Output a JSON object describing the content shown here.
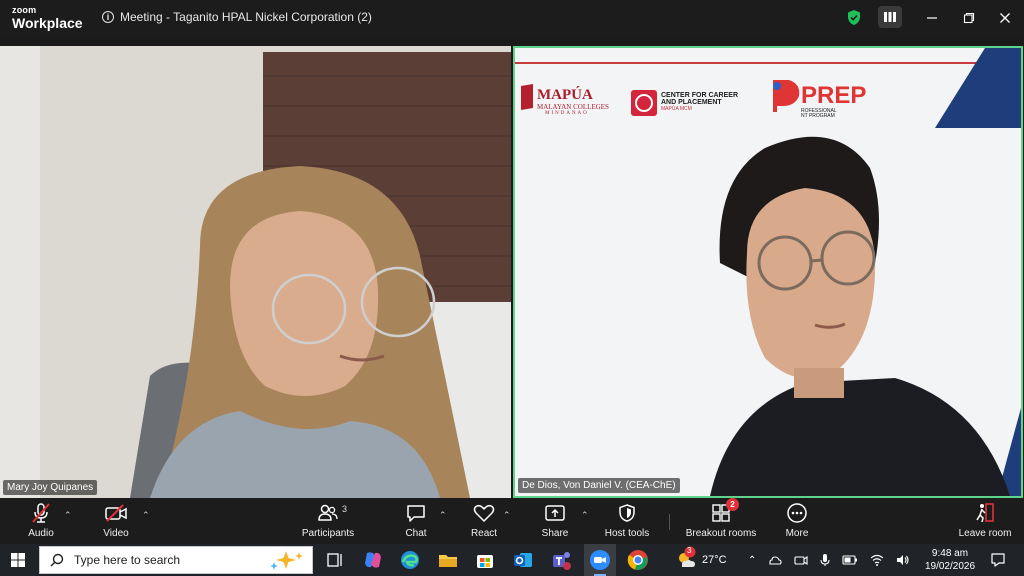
{
  "titlebar": {
    "brand_top": "zoom",
    "brand_main": "Workplace",
    "meeting_title": "Meeting - Taganito HPAL Nickel Corporation (2)"
  },
  "participants": [
    {
      "name": "Mary Joy Quipanes"
    },
    {
      "name": "De Dios, Von Daniel V. (CEA-ChE)"
    }
  ],
  "backdrop": {
    "logo1_main": "MAPÚA",
    "logo1_sub": "MALAYAN COLLEGES",
    "logo1_sub2": "MINDANAO",
    "logo2_line1": "CENTER FOR CAREER",
    "logo2_line2": "AND PLACEMENT",
    "logo2_line3": "MAPÚA MCM",
    "logo3_main": "PREP",
    "logo3_sub1": "ROFESSIONAL",
    "logo3_sub2": "NT PROGRAM"
  },
  "toolbar": {
    "audio": "Audio",
    "video": "Video",
    "participants": "Participants",
    "participants_count": "3",
    "chat": "Chat",
    "react": "React",
    "share": "Share",
    "host_tools": "Host tools",
    "breakout_rooms": "Breakout rooms",
    "breakout_badge": "2",
    "more": "More",
    "leave_room": "Leave room"
  },
  "taskbar": {
    "search_placeholder": "Type here to search",
    "chrome_badge": "3",
    "weather": "27°C",
    "time": "9:48 am",
    "date": "19/02/2026"
  },
  "colors": {
    "active_speaker_border": "#5fd38a",
    "badge_red": "#e0313a",
    "shield_green": "#1fbf5a"
  }
}
